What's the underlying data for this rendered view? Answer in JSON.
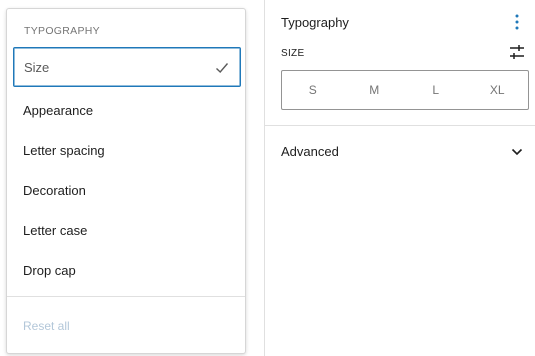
{
  "menu": {
    "heading": "TYPOGRAPHY",
    "items": [
      {
        "label": "Size",
        "selected": true,
        "icon": "check-icon"
      },
      {
        "label": "Appearance"
      },
      {
        "label": "Letter spacing"
      },
      {
        "label": "Decoration"
      },
      {
        "label": "Letter case"
      },
      {
        "label": "Drop cap"
      }
    ],
    "reset_label": "Reset all"
  },
  "panel": {
    "title": "Typography",
    "more_icon": "kebab-icon",
    "size": {
      "label": "SIZE",
      "options_icon": "sliders-icon",
      "options": [
        "S",
        "M",
        "L",
        "XL"
      ]
    },
    "advanced": {
      "label": "Advanced",
      "icon": "chevron-down-icon"
    }
  },
  "colors": {
    "accent": "#1f78b9",
    "text": "#1e1e1e",
    "muted": "#757575",
    "disabled": "#b3c7d9",
    "border": "#e0e0e0"
  }
}
